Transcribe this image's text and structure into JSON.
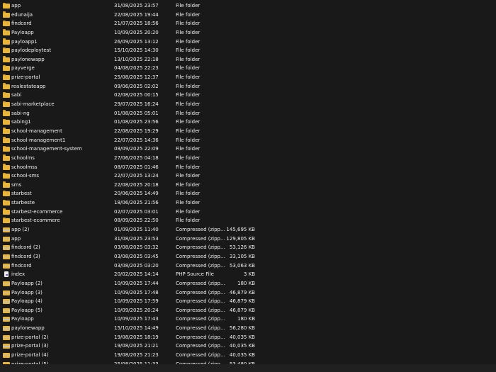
{
  "files": [
    {
      "name": "app",
      "date": "31/08/2025 23:57",
      "type": "File folder",
      "size": "",
      "icon": "folder"
    },
    {
      "name": "edunaija",
      "date": "22/08/2025 19:44",
      "type": "File folder",
      "size": "",
      "icon": "folder"
    },
    {
      "name": "findcord",
      "date": "21/07/2025 18:56",
      "type": "File folder",
      "size": "",
      "icon": "folder"
    },
    {
      "name": "Payloapp",
      "date": "10/09/2025 20:20",
      "type": "File folder",
      "size": "",
      "icon": "folder"
    },
    {
      "name": "payloapp1",
      "date": "26/09/2025 13:12",
      "type": "File folder",
      "size": "",
      "icon": "folder"
    },
    {
      "name": "paylodeploytest",
      "date": "15/10/2025 14:30",
      "type": "File folder",
      "size": "",
      "icon": "folder"
    },
    {
      "name": "paylonewapp",
      "date": "13/10/2025 22:18",
      "type": "File folder",
      "size": "",
      "icon": "folder"
    },
    {
      "name": "payverge",
      "date": "04/08/2025 22:23",
      "type": "File folder",
      "size": "",
      "icon": "folder"
    },
    {
      "name": "prize-portal",
      "date": "25/08/2025 12:37",
      "type": "File folder",
      "size": "",
      "icon": "folder"
    },
    {
      "name": "realestateapp",
      "date": "09/06/2025 02:02",
      "type": "File folder",
      "size": "",
      "icon": "folder"
    },
    {
      "name": "sabi",
      "date": "02/08/2025 00:15",
      "type": "File folder",
      "size": "",
      "icon": "folder"
    },
    {
      "name": "sabi-marketplace",
      "date": "29/07/2025 16:24",
      "type": "File folder",
      "size": "",
      "icon": "folder"
    },
    {
      "name": "sabi-ng",
      "date": "01/08/2025 05:01",
      "type": "File folder",
      "size": "",
      "icon": "folder"
    },
    {
      "name": "sabing1",
      "date": "01/08/2025 23:56",
      "type": "File folder",
      "size": "",
      "icon": "folder"
    },
    {
      "name": "school-management",
      "date": "22/08/2025 19:29",
      "type": "File folder",
      "size": "",
      "icon": "folder"
    },
    {
      "name": "school-management1",
      "date": "22/07/2025 14:36",
      "type": "File folder",
      "size": "",
      "icon": "folder"
    },
    {
      "name": "school-management-system",
      "date": "08/09/2025 22:09",
      "type": "File folder",
      "size": "",
      "icon": "folder"
    },
    {
      "name": "schoolms",
      "date": "27/06/2025 04:18",
      "type": "File folder",
      "size": "",
      "icon": "folder"
    },
    {
      "name": "schoolmss",
      "date": "08/07/2025 01:46",
      "type": "File folder",
      "size": "",
      "icon": "folder"
    },
    {
      "name": "school-sms",
      "date": "22/07/2025 13:24",
      "type": "File folder",
      "size": "",
      "icon": "folder"
    },
    {
      "name": "sms",
      "date": "22/08/2025 20:18",
      "type": "File folder",
      "size": "",
      "icon": "folder"
    },
    {
      "name": "starbest",
      "date": "20/06/2025 14:49",
      "type": "File folder",
      "size": "",
      "icon": "folder"
    },
    {
      "name": "starbeste",
      "date": "18/06/2025 21:56",
      "type": "File folder",
      "size": "",
      "icon": "folder"
    },
    {
      "name": "starbest-ecommerce",
      "date": "02/07/2025 03:01",
      "type": "File folder",
      "size": "",
      "icon": "folder"
    },
    {
      "name": "starbest-ecommere",
      "date": "08/09/2025 22:50",
      "type": "File folder",
      "size": "",
      "icon": "folder"
    },
    {
      "name": "app (2)",
      "date": "01/09/2025 11:40",
      "type": "Compressed (zipp...",
      "size": "145,695 KB",
      "icon": "zip"
    },
    {
      "name": "app",
      "date": "31/08/2025 23:53",
      "type": "Compressed (zipp...",
      "size": "129,805 KB",
      "icon": "zip"
    },
    {
      "name": "findcord (2)",
      "date": "03/08/2025 03:32",
      "type": "Compressed (zipp...",
      "size": "53,126 KB",
      "icon": "zip"
    },
    {
      "name": "findcord (3)",
      "date": "03/08/2025 03:45",
      "type": "Compressed (zipp...",
      "size": "33,105 KB",
      "icon": "zip"
    },
    {
      "name": "findcord",
      "date": "03/08/2025 03:20",
      "type": "Compressed (zipp...",
      "size": "53,063 KB",
      "icon": "zip"
    },
    {
      "name": "index",
      "date": "20/02/2025 14:14",
      "type": "PHP Source File",
      "size": "3 KB",
      "icon": "php"
    },
    {
      "name": "Payloapp (2)",
      "date": "10/09/2025 17:44",
      "type": "Compressed (zipp...",
      "size": "180 KB",
      "icon": "zip"
    },
    {
      "name": "Payloapp (3)",
      "date": "10/09/2025 17:48",
      "type": "Compressed (zipp...",
      "size": "46,879 KB",
      "icon": "zip"
    },
    {
      "name": "Payloapp (4)",
      "date": "10/09/2025 17:59",
      "type": "Compressed (zipp...",
      "size": "46,879 KB",
      "icon": "zip"
    },
    {
      "name": "Payloapp (5)",
      "date": "10/09/2025 20:24",
      "type": "Compressed (zipp...",
      "size": "46,879 KB",
      "icon": "zip"
    },
    {
      "name": "Payloapp",
      "date": "10/09/2025 17:43",
      "type": "Compressed (zipp...",
      "size": "180 KB",
      "icon": "zip"
    },
    {
      "name": "paylonewapp",
      "date": "15/10/2025 14:49",
      "type": "Compressed (zipp...",
      "size": "56,280 KB",
      "icon": "zip"
    },
    {
      "name": "prize-portal (2)",
      "date": "19/08/2025 18:19",
      "type": "Compressed (zipp...",
      "size": "40,035 KB",
      "icon": "zip"
    },
    {
      "name": "prize-portal (3)",
      "date": "19/08/2025 21:21",
      "type": "Compressed (zipp...",
      "size": "40,035 KB",
      "icon": "zip"
    },
    {
      "name": "prize-portal (4)",
      "date": "19/08/2025 21:23",
      "type": "Compressed (zipp...",
      "size": "40,035 KB",
      "icon": "zip"
    },
    {
      "name": "prize-portal (5)",
      "date": "25/08/2025 11:33",
      "type": "Compressed (zipp...",
      "size": "53,480 KB",
      "icon": "zip"
    }
  ]
}
